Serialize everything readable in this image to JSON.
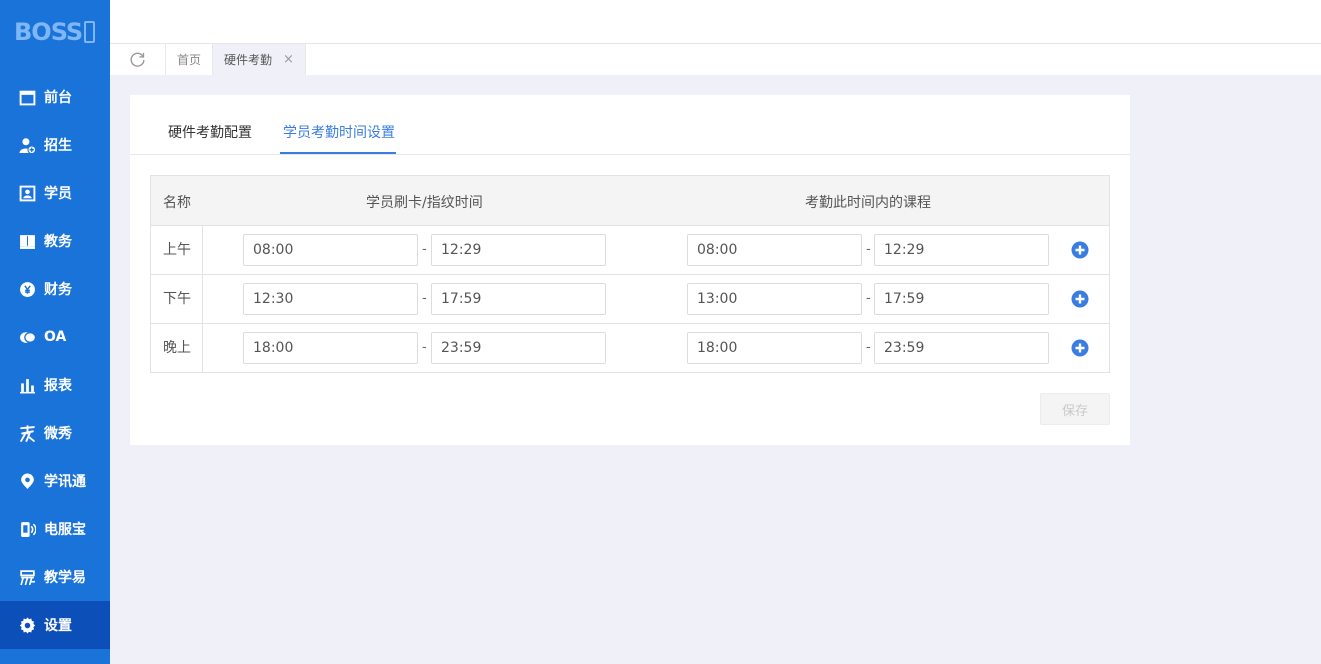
{
  "logo": {
    "text": "BOSS"
  },
  "sidebar": {
    "items": [
      {
        "label": "前台",
        "icon": "calendar-icon"
      },
      {
        "label": "招生",
        "icon": "user-add-icon"
      },
      {
        "label": "学员",
        "icon": "id-card-icon"
      },
      {
        "label": "教务",
        "icon": "book-icon"
      },
      {
        "label": "财务",
        "icon": "yen-icon"
      },
      {
        "label": "OA",
        "icon": "chat-icon"
      },
      {
        "label": "报表",
        "icon": "bar-chart-icon"
      },
      {
        "label": "微秀",
        "icon": "xiu-icon"
      },
      {
        "label": "学讯通",
        "icon": "location-icon"
      },
      {
        "label": "电服宝",
        "icon": "phone-icon"
      },
      {
        "label": "教学易",
        "icon": "teach-icon"
      },
      {
        "label": "设置",
        "icon": "gear-icon",
        "active": true
      }
    ]
  },
  "tabs": {
    "items": [
      {
        "label": "首页",
        "active": false
      },
      {
        "label": "硬件考勤",
        "active": true,
        "closable": true
      }
    ],
    "close_glyph": "×"
  },
  "page": {
    "inner_tabs": [
      "硬件考勤配置",
      "学员考勤时间设置"
    ],
    "active_inner_tab": 1,
    "table": {
      "headers": {
        "name": "名称",
        "card_time": "学员刷卡/指纹时间",
        "course_time": "考勤此时间内的课程"
      },
      "rows": [
        {
          "name": "上午",
          "card_start": "08:00",
          "card_end": "12:29",
          "course_start": "08:00",
          "course_end": "12:29"
        },
        {
          "name": "下午",
          "card_start": "12:30",
          "card_end": "17:59",
          "course_start": "13:00",
          "course_end": "17:59"
        },
        {
          "name": "晚上",
          "card_start": "18:00",
          "card_end": "23:59",
          "course_start": "18:00",
          "course_end": "23:59"
        }
      ],
      "separator": "-"
    },
    "save_label": "保存"
  },
  "colors": {
    "sidebar_bg": "#1a73d9",
    "sidebar_active": "#0d4fb8",
    "accent": "#3a7de0",
    "page_bg": "#f0f1f8"
  }
}
